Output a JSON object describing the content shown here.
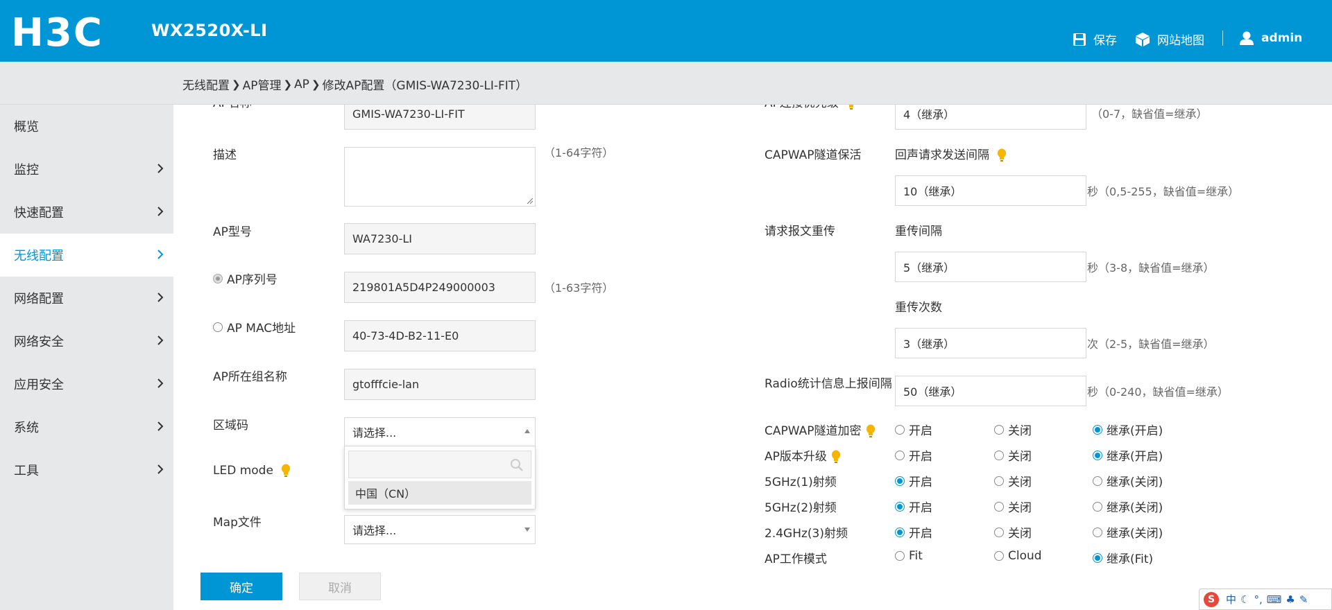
{
  "header": {
    "product": "WX2520X-LI",
    "save_label": "保存",
    "sitemap_label": "网站地图",
    "user_label": "admin",
    "bg_color": "#0096d6"
  },
  "breadcrumb": [
    "无线配置",
    "AP管理",
    "AP",
    "修改AP配置（GMIS-WA7230-LI-FIT）"
  ],
  "sidebar": {
    "items": [
      {
        "label": "概览",
        "has_chevron": false,
        "active": false
      },
      {
        "label": "监控",
        "has_chevron": true,
        "active": false
      },
      {
        "label": "快速配置",
        "has_chevron": true,
        "active": false
      },
      {
        "label": "无线配置",
        "has_chevron": true,
        "active": true
      },
      {
        "label": "网络配置",
        "has_chevron": true,
        "active": false
      },
      {
        "label": "网络安全",
        "has_chevron": true,
        "active": false
      },
      {
        "label": "应用安全",
        "has_chevron": true,
        "active": false
      },
      {
        "label": "系统",
        "has_chevron": true,
        "active": false
      },
      {
        "label": "工具",
        "has_chevron": true,
        "active": false
      }
    ]
  },
  "left_form": {
    "ap_name_label": "AP名称",
    "ap_name_value": "GMIS-WA7230-LI-FIT",
    "desc_label": "描述",
    "desc_hint": "（1-64字符）",
    "model_label": "AP型号",
    "model_value": "WA7230-LI",
    "serial_label": "AP序列号",
    "serial_value": "219801A5D4P249000003",
    "serial_hint": "（1-63字符）",
    "mac_label": "AP MAC地址",
    "mac_value": "40-73-4D-B2-11-E0",
    "group_label": "AP所在组名称",
    "group_value": "gtofffcie-lan",
    "region_label": "区域码",
    "region_placeholder": "请选择...",
    "region_option": "中国（CN）",
    "led_label": "LED mode",
    "map_label": "Map文件",
    "map_placeholder": "请选择..."
  },
  "right_form": {
    "priority_label": "AP连接优先级",
    "priority_value": "4（继承）",
    "priority_hint": "（0-7，缺省值=继承）",
    "capwap_keepalive_label": "CAPWAP隧道保活",
    "echo_interval_label": "回声请求发送间隔",
    "echo_interval_value": "10（继承）",
    "echo_interval_hint": "秒（0,5-255，缺省值=继承）",
    "retrans_label": "请求报文重传",
    "retrans_interval_label": "重传间隔",
    "retrans_interval_value": "5（继承）",
    "retrans_interval_hint": "秒（3-8，缺省值=继承）",
    "retrans_count_label": "重传次数",
    "retrans_count_value": "3（继承）",
    "retrans_count_hint": "次（2-5，缺省值=继承）",
    "radio_stats_label": "Radio统计信息上报间隔",
    "radio_stats_value": "50（继承）",
    "radio_stats_hint": "秒（0-240，缺省值=继承）",
    "radio_rows": [
      {
        "label": "CAPWAP隧道加密",
        "bulb": true,
        "opts": [
          "开启",
          "关闭",
          "继承(开启)"
        ],
        "selected": 2
      },
      {
        "label": "AP版本升级",
        "bulb": true,
        "opts": [
          "开启",
          "关闭",
          "继承(开启)"
        ],
        "selected": 2
      },
      {
        "label": "5GHz(1)射频",
        "bulb": false,
        "opts": [
          "开启",
          "关闭",
          "继承(关闭)"
        ],
        "selected": 0
      },
      {
        "label": "5GHz(2)射频",
        "bulb": false,
        "opts": [
          "开启",
          "关闭",
          "继承(关闭)"
        ],
        "selected": 0
      },
      {
        "label": "2.4GHz(3)射频",
        "bulb": false,
        "opts": [
          "开启",
          "关闭",
          "继承(关闭)"
        ],
        "selected": 0
      },
      {
        "label": "AP工作模式",
        "bulb": false,
        "opts": [
          "Fit",
          "Cloud",
          "继承(Fit)"
        ],
        "selected": 2
      }
    ]
  },
  "buttons": {
    "ok": "确定",
    "cancel": "取消"
  },
  "ime": {
    "mode": "中",
    "logo": "S"
  }
}
